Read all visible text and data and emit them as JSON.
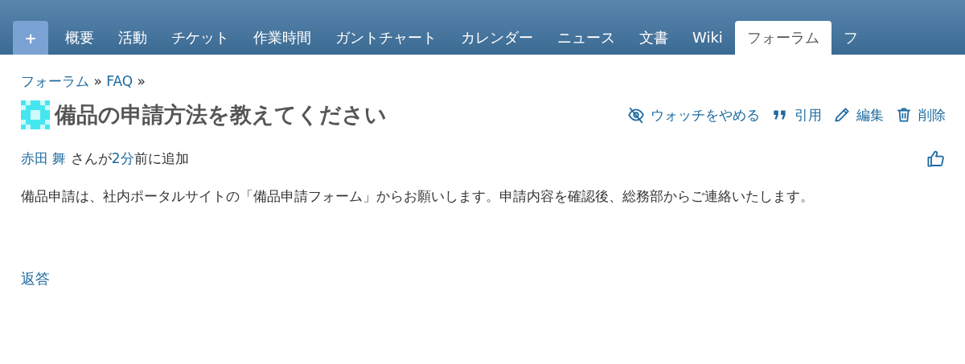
{
  "main_menu": {
    "new_button": "+",
    "tabs": [
      {
        "label": "概要",
        "selected": false
      },
      {
        "label": "活動",
        "selected": false
      },
      {
        "label": "チケット",
        "selected": false
      },
      {
        "label": "作業時間",
        "selected": false
      },
      {
        "label": "ガントチャート",
        "selected": false
      },
      {
        "label": "カレンダー",
        "selected": false
      },
      {
        "label": "ニュース",
        "selected": false
      },
      {
        "label": "文書",
        "selected": false
      },
      {
        "label": "Wiki",
        "selected": false
      },
      {
        "label": "フォーラム",
        "selected": true
      },
      {
        "label": "フ",
        "selected": false
      }
    ]
  },
  "breadcrumb": [
    {
      "label": "フォーラム",
      "separator": "»"
    },
    {
      "label": "FAQ",
      "separator": "»"
    }
  ],
  "topic": {
    "title": "備品の申請方法を教えてください",
    "actions": [
      {
        "kind": "unwatch",
        "label": "ウォッチをやめる"
      },
      {
        "kind": "quote",
        "label": "引用"
      },
      {
        "kind": "edit",
        "label": "編集"
      },
      {
        "kind": "delete",
        "label": "削除"
      }
    ],
    "author": "赤田 舞",
    "author_suffix": " さんが",
    "time_ago": "2分",
    "time_suffix": "前に追加",
    "body": "備品申請は、社内ポータルサイトの「備品申請フォーム」からお願いします。申請内容を確認後、総務部からご連絡いたします。"
  },
  "reply_link": "返答"
}
